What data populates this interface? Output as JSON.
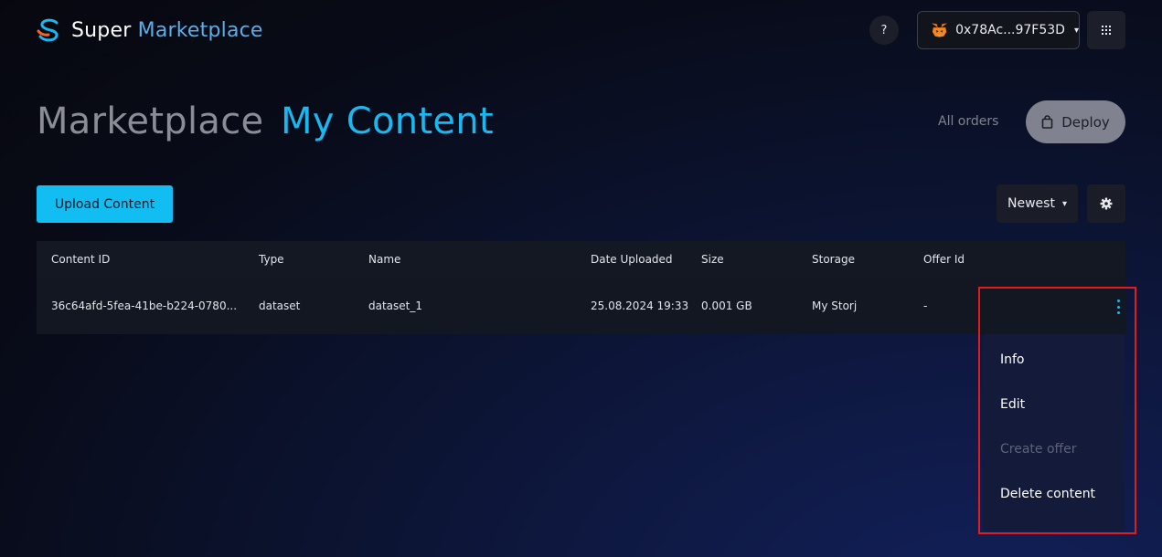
{
  "header": {
    "logo_word1": "Super",
    "logo_word2": "Marketplace",
    "help_label": "?",
    "wallet_address": "0x78Ac...97F53D",
    "wallet_caret": "▾"
  },
  "nav": {
    "tab_marketplace": "Marketplace",
    "tab_my_content": "My Content",
    "all_orders": "All orders",
    "deploy_label": "Deploy"
  },
  "toolbar": {
    "upload_label": "Upload Content",
    "sort_label": "Newest",
    "sort_caret": "▾"
  },
  "table": {
    "columns": [
      "Content ID",
      "Type",
      "Name",
      "Date Uploaded",
      "Size",
      "Storage",
      "Offer Id"
    ],
    "rows": [
      [
        "36c64afd-5fea-41be-b224-0780...",
        "dataset",
        "dataset_1",
        "25.08.2024 19:33",
        "0.001 GB",
        "My Storj",
        "-"
      ]
    ]
  },
  "row_menu": {
    "items": [
      {
        "label": "Info",
        "enabled": true
      },
      {
        "label": "Edit",
        "enabled": true
      },
      {
        "label": "Create offer",
        "enabled": false
      },
      {
        "label": "Delete content",
        "enabled": true
      }
    ]
  },
  "colors": {
    "accent": "#1ab8f0",
    "highlight_border": "#e01c1c"
  }
}
